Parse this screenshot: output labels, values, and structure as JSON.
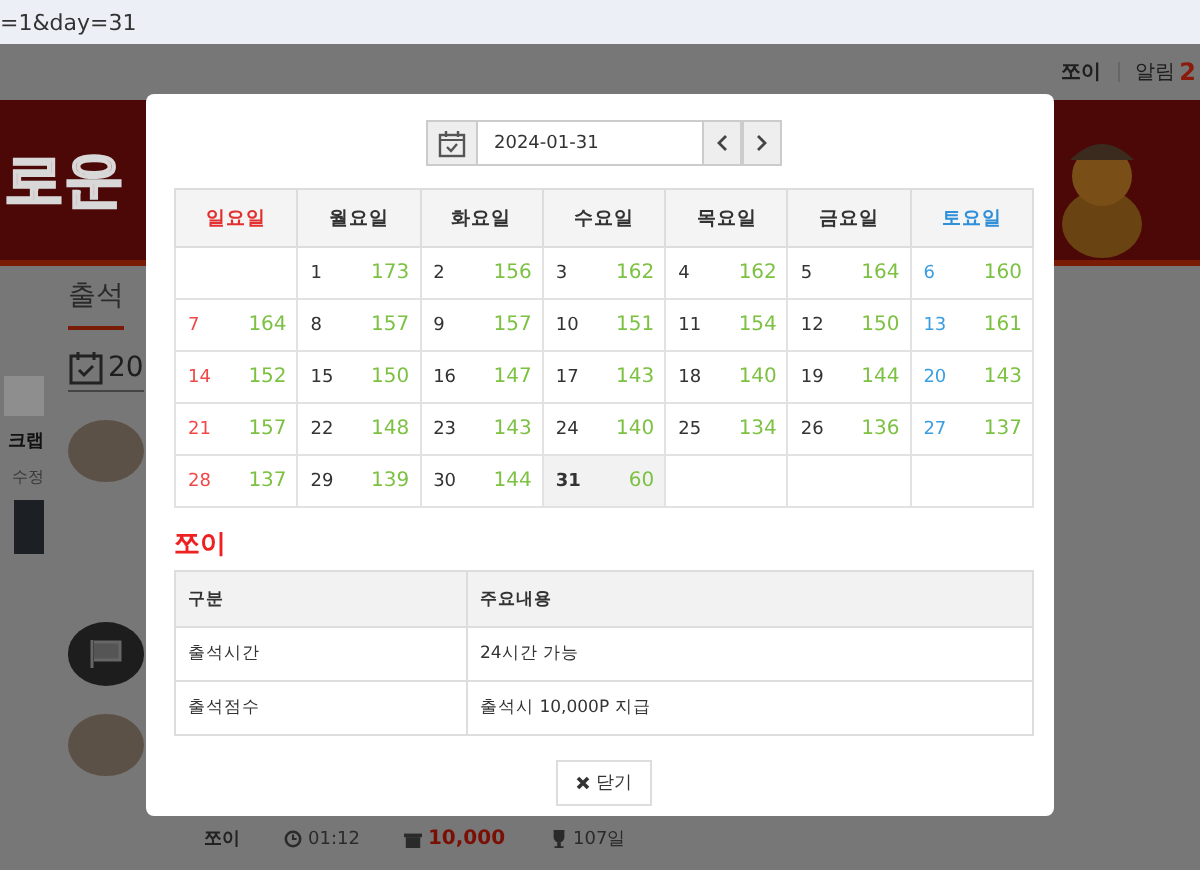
{
  "address_bar": {
    "url_fragment": "=1&day=31"
  },
  "page": {
    "user_menu": {
      "username": "쪼이",
      "alerts_label": "알림",
      "alerts_count": "2"
    },
    "banner": {
      "logo_text": "로운"
    },
    "heading": "출석",
    "date_fragment": "20",
    "sidebar": {
      "label": "크랩",
      "edit_link": "수정"
    },
    "attendance_row": {
      "name": "쪼이",
      "time": "01:12",
      "points": "10,000",
      "days": "107일"
    }
  },
  "modal": {
    "date_picker": {
      "value": "2024-01-31"
    },
    "calendar": {
      "weekdays": [
        {
          "label": "일요일",
          "kind": "sunday"
        },
        {
          "label": "월요일",
          "kind": "weekday"
        },
        {
          "label": "화요일",
          "kind": "weekday"
        },
        {
          "label": "수요일",
          "kind": "weekday"
        },
        {
          "label": "목요일",
          "kind": "weekday"
        },
        {
          "label": "금요일",
          "kind": "weekday"
        },
        {
          "label": "토요일",
          "kind": "saturday"
        }
      ],
      "weeks": [
        [
          {
            "day": "1",
            "count": "173",
            "selected": false
          },
          {
            "day": "2",
            "count": "156",
            "selected": false
          },
          {
            "day": "3",
            "count": "162",
            "selected": false
          },
          {
            "day": "4",
            "count": "162",
            "selected": false
          },
          {
            "day": "5",
            "count": "164",
            "selected": false
          },
          {
            "day": "6",
            "count": "160",
            "selected": false
          }
        ],
        [
          {
            "day": "7",
            "count": "164",
            "selected": false
          },
          {
            "day": "8",
            "count": "157",
            "selected": false
          },
          {
            "day": "9",
            "count": "157",
            "selected": false
          },
          {
            "day": "10",
            "count": "151",
            "selected": false
          },
          {
            "day": "11",
            "count": "154",
            "selected": false
          },
          {
            "day": "12",
            "count": "150",
            "selected": false
          },
          {
            "day": "13",
            "count": "161",
            "selected": false
          }
        ],
        [
          {
            "day": "14",
            "count": "152",
            "selected": false
          },
          {
            "day": "15",
            "count": "150",
            "selected": false
          },
          {
            "day": "16",
            "count": "147",
            "selected": false
          },
          {
            "day": "17",
            "count": "143",
            "selected": false
          },
          {
            "day": "18",
            "count": "140",
            "selected": false
          },
          {
            "day": "19",
            "count": "144",
            "selected": false
          },
          {
            "day": "20",
            "count": "143",
            "selected": false
          }
        ],
        [
          {
            "day": "21",
            "count": "157",
            "selected": false
          },
          {
            "day": "22",
            "count": "148",
            "selected": false
          },
          {
            "day": "23",
            "count": "143",
            "selected": false
          },
          {
            "day": "24",
            "count": "140",
            "selected": false
          },
          {
            "day": "25",
            "count": "134",
            "selected": false
          },
          {
            "day": "26",
            "count": "136",
            "selected": false
          },
          {
            "day": "27",
            "count": "137",
            "selected": false
          }
        ],
        [
          {
            "day": "28",
            "count": "137",
            "selected": false
          },
          {
            "day": "29",
            "count": "139",
            "selected": false
          },
          {
            "day": "30",
            "count": "144",
            "selected": false
          },
          {
            "day": "31",
            "count": "60",
            "selected": true
          }
        ]
      ]
    },
    "info": {
      "title": "쪼이",
      "columns": [
        "구분",
        "주요내용"
      ],
      "rows": [
        [
          "출석시간",
          "24시간 가능"
        ],
        [
          "출석점수",
          "출석시 10,000P 지급"
        ]
      ]
    },
    "close_button": "닫기"
  }
}
